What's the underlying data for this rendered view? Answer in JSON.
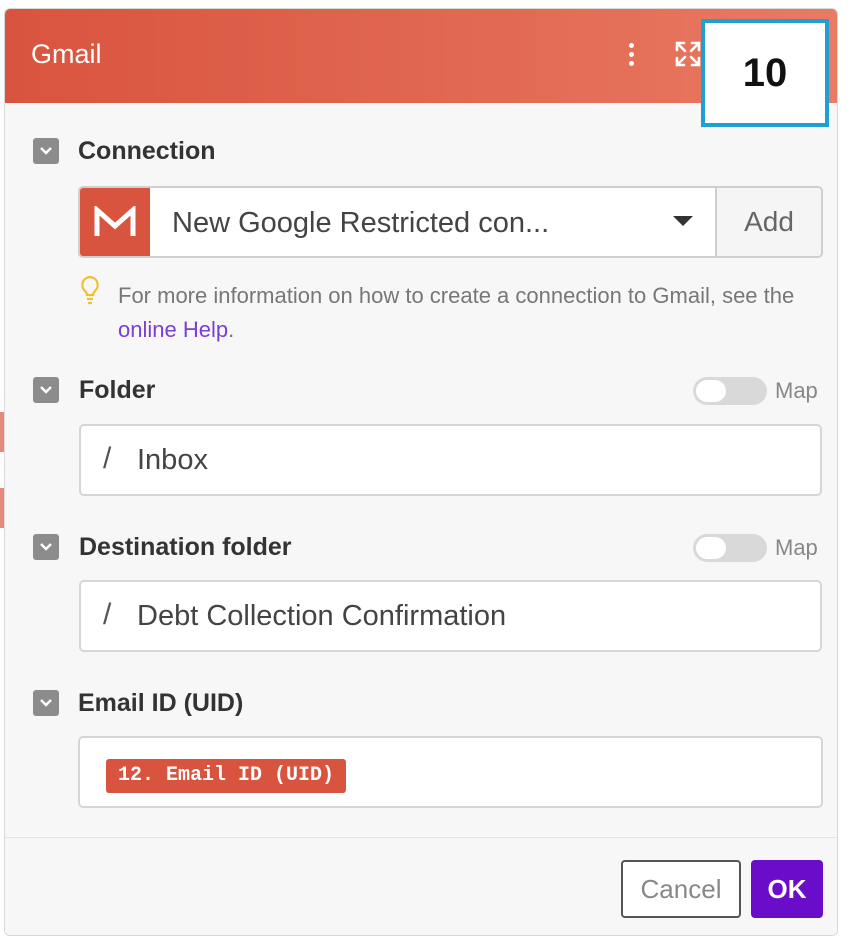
{
  "header": {
    "title": "Gmail",
    "step_badge": "10",
    "accent": "#d9543f"
  },
  "connection": {
    "label": "Connection",
    "selected_value": "New Google Restricted con...",
    "add_label": "Add",
    "hint_text": "For more information on how to create a connection to Gmail, see the ",
    "hint_link": "online Help",
    "hint_end": "."
  },
  "folder": {
    "label": "Folder",
    "map_label": "Map",
    "map_enabled": false,
    "value": "Inbox"
  },
  "destination_folder": {
    "label": "Destination folder",
    "map_label": "Map",
    "map_enabled": false,
    "value": "Debt Collection Confirmation"
  },
  "email_id": {
    "label": "Email ID (UID)",
    "mapped_value": "12. Email ID (UID)"
  },
  "footer": {
    "cancel_label": "Cancel",
    "ok_label": "OK",
    "ok_color": "#6a0dca"
  }
}
